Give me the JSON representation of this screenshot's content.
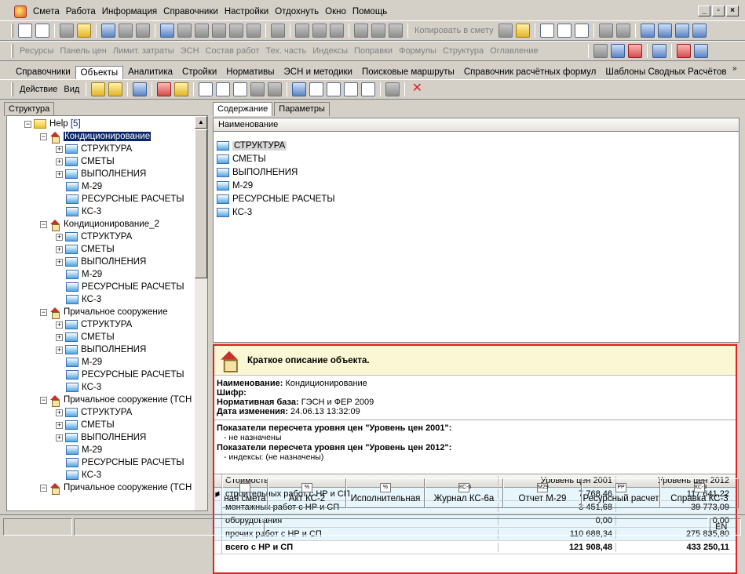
{
  "menu": [
    "Смета",
    "Работа",
    "Информация",
    "Справочники",
    "Настройки",
    "Отдохнуть",
    "Окно",
    "Помощь"
  ],
  "toolbar2": {
    "copy_label": "Копировать в смету"
  },
  "toolbar3": [
    "Ресурсы",
    "Панель цен",
    "Лимит. затраты",
    "ЭСН",
    "Состав работ",
    "Тех. часть",
    "Индексы",
    "Поправки",
    "Формулы",
    "Структура",
    "Оглавление"
  ],
  "tabs": [
    "Справочники",
    "Объекты",
    "Аналитика",
    "Стройки",
    "Нормативы",
    "ЭСН и методики",
    "Поисковые маршруты",
    "Справочник расчётных формул",
    "Шаблоны Сводных Расчётов"
  ],
  "actions": {
    "action": "Действие",
    "view": "Вид"
  },
  "left": {
    "tab": "Структура"
  },
  "tree": {
    "root": "Help",
    "root_count": "[5]",
    "objects": [
      "Кондиционирование",
      "Кондиционирование_2",
      "Причальное сооружение",
      "Причальное сооружение (ТСН",
      "Причальное сооружение (ТСН"
    ],
    "children": [
      "СТРУКТУРА",
      "СМЕТЫ",
      "ВЫПОЛНЕНИЯ",
      "М-29",
      "РЕСУРСНЫЕ РАСЧЕТЫ",
      "КС-3"
    ]
  },
  "right": {
    "tab_content": "Содержание",
    "tab_params": "Параметры",
    "col_name": "Наименование"
  },
  "list": [
    "СТРУКТУРА",
    "СМЕТЫ",
    "ВЫПОЛНЕНИЯ",
    "М-29",
    "РЕСУРСНЫЕ РАСЧЕТЫ",
    "КС-3"
  ],
  "info": {
    "title": "Краткое описание объекта.",
    "name_label": "Наименование:",
    "name_value": "Кондиционирование",
    "cipher_label": "Шифр:",
    "base_label": "Нормативная база:",
    "base_value": "ГЭСН и ФЕР 2009",
    "date_label": "Дата изменения:",
    "date_value": "24.06.13 13:32:09",
    "p2001_label": "Показатели пересчета уровня цен \"Уровень цен 2001\":",
    "p2001_value": "- не назначены",
    "p2012_label": "Показатели пересчета уровня цен \"Уровень цен 2012\":",
    "p2012_value": "- индексы: (не назначены)"
  },
  "grid": {
    "headers": [
      "Стоимость",
      "Уровень цен 2001",
      "Уровень цен 2012"
    ],
    "rows": [
      [
        "строительных работ с НР и СП",
        "7 768,46",
        "117 641,22"
      ],
      [
        "монтажных работ с НР и СП",
        "3 451,68",
        "39 773,09"
      ],
      [
        "оборудования",
        "0,00",
        "0,00"
      ],
      [
        "прочих работ с НР и СП",
        "110 688,34",
        "275 835,80"
      ],
      [
        "всего с НР и СП",
        "121 908,48",
        "433 250,11"
      ]
    ]
  },
  "bottom_tabs": [
    {
      "icon": "",
      "label": "ная смета"
    },
    {
      "icon": "%",
      "label": "Акт КС-2"
    },
    {
      "icon": "%",
      "label": "Исполнительная"
    },
    {
      "icon": "КС-6",
      "label": "Журнал КС-6а"
    },
    {
      "icon": "М29",
      "label": "Отчет М-29"
    },
    {
      "icon": "РР",
      "label": "Ресурсный расчет"
    },
    {
      "icon": "КС-3",
      "label": "Справка КС-3"
    }
  ],
  "status": {
    "lang": "EN"
  }
}
